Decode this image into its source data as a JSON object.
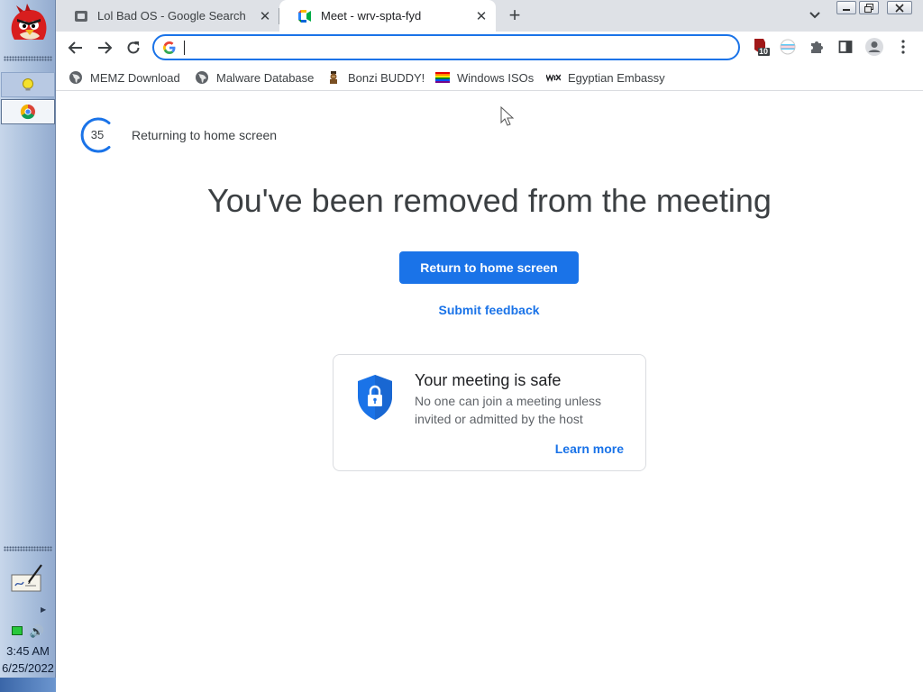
{
  "taskbar": {
    "logo_icon": "angry-bird-red-icon",
    "tasks": [
      {
        "icon": "lightbulb-icon"
      },
      {
        "icon": "chrome-icon"
      }
    ],
    "clock_time": "3:45 AM",
    "clock_date": "6/25/2022"
  },
  "browser": {
    "tabs": [
      {
        "title": "Lol Bad OS - Google Search",
        "icon": "google-page-icon",
        "active": false
      },
      {
        "title": "Meet - wrv-spta-fyd",
        "icon": "google-meet-icon",
        "active": true
      }
    ],
    "omnibox": {
      "value": ""
    },
    "extension_badge": "10",
    "bookmarks": [
      {
        "label": "MEMZ Download",
        "icon": "globe-icon"
      },
      {
        "label": "Malware Database",
        "icon": "globe-icon"
      },
      {
        "label": "Bonzi BUDDY!",
        "icon": "bonzi-icon"
      },
      {
        "label": "Windows ISOs",
        "icon": "rainbow-flag-icon"
      },
      {
        "label": "Egyptian Embassy",
        "icon": "wix-icon"
      }
    ]
  },
  "meet": {
    "countdown": "35",
    "returning_text": "Returning to home screen",
    "heading": "You've been removed from the meeting",
    "return_button": "Return to home screen",
    "feedback_link": "Submit feedback",
    "safe_card": {
      "title": "Your meeting is safe",
      "body": "No one can join a meeting unless invited or admitted by the host",
      "learn_more": "Learn more"
    }
  },
  "colors": {
    "accent": "#1a73e8",
    "text": "#3c4043",
    "taskbar": "#a9bfdc"
  }
}
